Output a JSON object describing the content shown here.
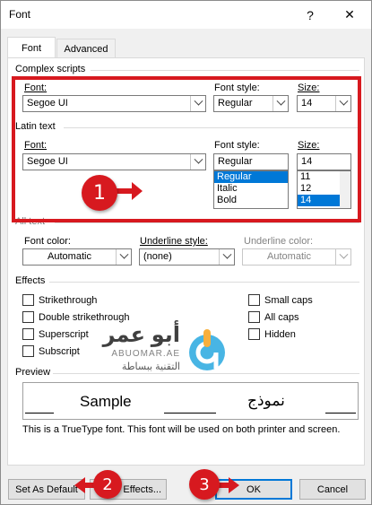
{
  "window": {
    "title": "Font",
    "help_label": "?",
    "close_label": "✕"
  },
  "tabs": [
    {
      "label": "Font"
    },
    {
      "label": "Advanced"
    }
  ],
  "complex": {
    "header": "Complex scripts",
    "font_label": "Font:",
    "font_value": "Segoe UI",
    "style_label": "Font style:",
    "style_value": "Regular",
    "size_label": "Size:",
    "size_value": "14"
  },
  "latin": {
    "header": "Latin text",
    "font_label": "Font:",
    "font_value": "Segoe UI",
    "style_label": "Font style:",
    "style_value": "Regular",
    "style_options": [
      "Regular",
      "Italic",
      "Bold"
    ],
    "style_selected": "Regular",
    "size_label": "Size:",
    "size_value": "14",
    "size_options": [
      "11",
      "12",
      "14"
    ],
    "size_selected": "14"
  },
  "alltext": {
    "header": "All text",
    "color_label": "Font color:",
    "color_value": "Automatic",
    "underline_label": "Underline style:",
    "underline_value": "(none)",
    "ucolor_label": "Underline color:",
    "ucolor_value": "Automatic"
  },
  "effects": {
    "header": "Effects",
    "left": [
      "Strikethrough",
      "Double strikethrough",
      "Superscript",
      "Subscript"
    ],
    "right": [
      "Small caps",
      "All caps",
      "Hidden"
    ]
  },
  "preview": {
    "header": "Preview",
    "sample_latin": "Sample",
    "sample_arabic": "نموذج",
    "note": "This is a TrueType font. This font will be used on both printer and screen."
  },
  "buttons": {
    "set_default": "Set As Default",
    "text_effects": "Effects...",
    "ok": "OK",
    "cancel": "Cancel"
  },
  "annotations": {
    "badge1": "1",
    "badge2": "2",
    "badge3": "3",
    "color": "#d7191f"
  },
  "watermark": {
    "arabic_name": "أبو عمر",
    "latin_name": "ABUOMAR.AE",
    "tagline": "التقنية ببساطة"
  }
}
